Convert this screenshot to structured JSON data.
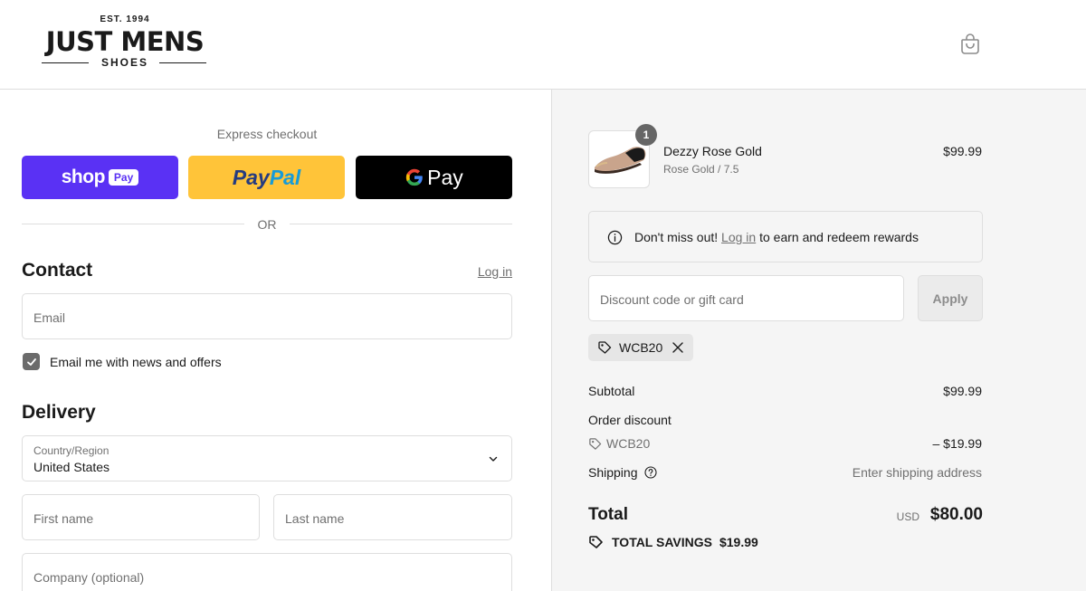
{
  "brand": {
    "est": "EST. 1994",
    "name": "JUST MENS",
    "sub": "SHOES"
  },
  "express": {
    "title": "Express checkout",
    "shop_pay": {
      "word": "shop",
      "chip": "Pay"
    },
    "paypal": {
      "part1": "Pay",
      "part2": "Pal"
    },
    "gpay": {
      "word": "Pay"
    },
    "or": "OR"
  },
  "contact": {
    "title": "Contact",
    "login": "Log in",
    "email_placeholder": "Email",
    "newsletter_label": "Email me with news and offers",
    "newsletter_checked": true
  },
  "delivery": {
    "title": "Delivery",
    "country_label": "Country/Region",
    "country_value": "United States",
    "first_name_placeholder": "First name",
    "last_name_placeholder": "Last name",
    "company_placeholder": "Company (optional)"
  },
  "summary": {
    "item": {
      "quantity": "1",
      "name": "Dezzy Rose Gold",
      "variant": "Rose Gold / 7.5",
      "price": "$99.99"
    },
    "rewards": {
      "before": "Don't miss out!",
      "link": "Log in",
      "after": "to earn and redeem rewards"
    },
    "discount": {
      "placeholder": "Discount code or gift card",
      "apply": "Apply",
      "applied_code": "WCB20"
    },
    "subtotal_label": "Subtotal",
    "subtotal_value": "$99.99",
    "order_discount_label": "Order discount",
    "order_discount_code": "WCB20",
    "order_discount_value": "– $19.99",
    "shipping_label": "Shipping",
    "shipping_value": "Enter shipping address",
    "total_label": "Total",
    "total_currency": "USD",
    "total_value": "$80.00",
    "savings_label": "TOTAL SAVINGS",
    "savings_value": "$19.99"
  },
  "colors": {
    "shop_pay": "#5a31f4",
    "paypal": "#ffc439",
    "gpay": "#000000",
    "summary_bg": "#f5f5f5"
  }
}
